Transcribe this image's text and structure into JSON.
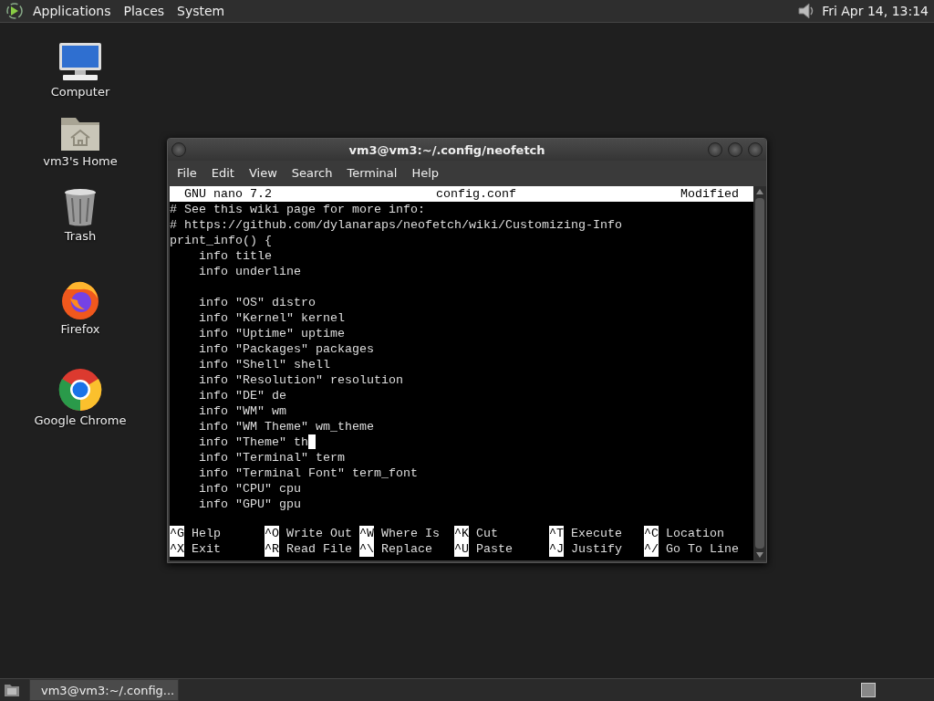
{
  "top_panel": {
    "menus": [
      "Applications",
      "Places",
      "System"
    ],
    "clock": "Fri Apr 14, 13:14"
  },
  "desktop_icons": [
    {
      "kind": "computer",
      "label": "Computer"
    },
    {
      "kind": "home",
      "label": "vm3's Home"
    },
    {
      "kind": "trash",
      "label": "Trash"
    },
    {
      "kind": "firefox",
      "label": "Firefox"
    },
    {
      "kind": "chrome",
      "label": "Google Chrome"
    }
  ],
  "window": {
    "title": "vm3@vm3:~/.config/neofetch",
    "menu": [
      "File",
      "Edit",
      "View",
      "Search",
      "Terminal",
      "Help"
    ],
    "nano": {
      "version": "GNU nano 7.2",
      "filename": "config.conf",
      "status": "Modified",
      "lines": [
        {
          "kind": "text",
          "text": "# See this wiki page for more info:",
          "cursor": false
        },
        {
          "kind": "text",
          "text": "# https://github.com/dylanaraps/neofetch/wiki/Customizing-Info",
          "cursor": false
        },
        {
          "kind": "text",
          "text": "print_info() {",
          "cursor": false
        },
        {
          "kind": "text",
          "text": "    info title",
          "cursor": false
        },
        {
          "kind": "text",
          "text": "    info underline",
          "cursor": false
        },
        {
          "kind": "blank"
        },
        {
          "kind": "text",
          "text": "    info \"OS\" distro",
          "cursor": false
        },
        {
          "kind": "text",
          "text": "    info \"Kernel\" kernel",
          "cursor": false
        },
        {
          "kind": "text",
          "text": "    info \"Uptime\" uptime",
          "cursor": false
        },
        {
          "kind": "text",
          "text": "    info \"Packages\" packages",
          "cursor": false
        },
        {
          "kind": "text",
          "text": "    info \"Shell\" shell",
          "cursor": false
        },
        {
          "kind": "text",
          "text": "    info \"Resolution\" resolution",
          "cursor": false
        },
        {
          "kind": "text",
          "text": "    info \"DE\" de",
          "cursor": false
        },
        {
          "kind": "text",
          "text": "    info \"WM\" wm",
          "cursor": false
        },
        {
          "kind": "text",
          "text": "    info \"WM Theme\" wm_theme",
          "cursor": false
        },
        {
          "kind": "text",
          "text": "    info \"Theme\" th",
          "cursor": true
        },
        {
          "kind": "text",
          "text": "    info \"Terminal\" term",
          "cursor": false
        },
        {
          "kind": "text",
          "text": "    info \"Terminal Font\" term_font",
          "cursor": false
        },
        {
          "kind": "text",
          "text": "    info \"CPU\" cpu",
          "cursor": false
        },
        {
          "kind": "text",
          "text": "    info \"GPU\" gpu",
          "cursor": false
        }
      ],
      "shortcuts": [
        [
          {
            "key": "^G",
            "label": "Help"
          },
          {
            "key": "^O",
            "label": "Write Out"
          },
          {
            "key": "^W",
            "label": "Where Is"
          },
          {
            "key": "^K",
            "label": "Cut"
          },
          {
            "key": "^T",
            "label": "Execute"
          },
          {
            "key": "^C",
            "label": "Location"
          }
        ],
        [
          {
            "key": "^X",
            "label": "Exit"
          },
          {
            "key": "^R",
            "label": "Read File"
          },
          {
            "key": "^\\",
            "label": "Replace"
          },
          {
            "key": "^U",
            "label": "Paste"
          },
          {
            "key": "^J",
            "label": "Justify"
          },
          {
            "key": "^/",
            "label": "Go To Line"
          }
        ]
      ]
    }
  },
  "taskbar": {
    "tasks": [
      {
        "label": "vm3@vm3:~/.config...",
        "selected": true
      }
    ]
  }
}
